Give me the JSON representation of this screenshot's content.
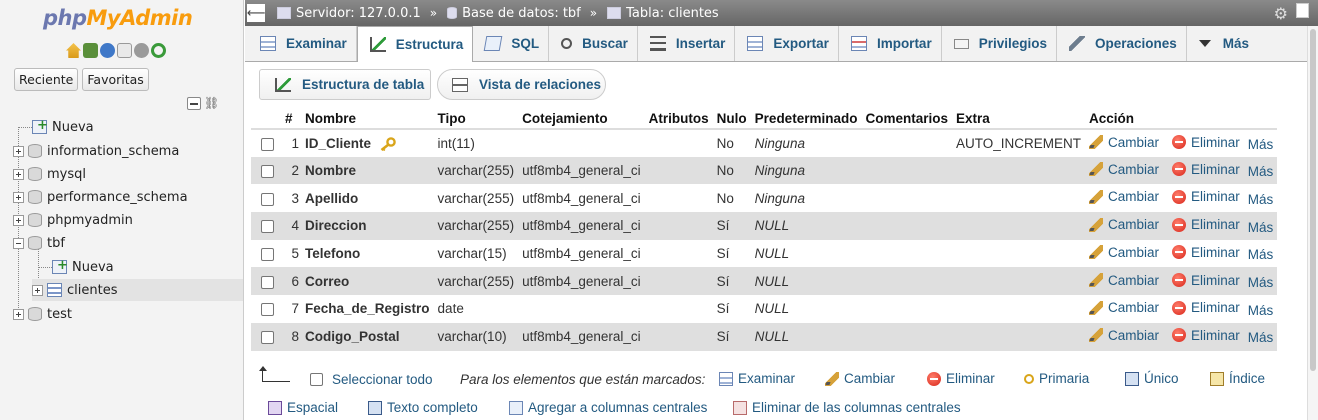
{
  "nav": {
    "logo_a": "php",
    "logo_b": "MyAdmin",
    "btn_recent": "Reciente",
    "btn_fav": "Favoritas",
    "tree": [
      {
        "label": "Nueva",
        "kind": "new",
        "level": 0
      },
      {
        "label": "information_schema",
        "kind": "db",
        "level": 0
      },
      {
        "label": "mysql",
        "kind": "db",
        "level": 0
      },
      {
        "label": "performance_schema",
        "kind": "db",
        "level": 0
      },
      {
        "label": "phpmyadmin",
        "kind": "db",
        "level": 0
      },
      {
        "label": "tbf",
        "kind": "db-open",
        "level": 0
      },
      {
        "label": "Nueva",
        "kind": "new",
        "level": 1
      },
      {
        "label": "clientes",
        "kind": "table",
        "level": 1
      },
      {
        "label": "test",
        "kind": "db",
        "level": 0
      }
    ]
  },
  "breadcrumb": {
    "server": "Servidor: 127.0.0.1",
    "database": "Base de datos: tbf",
    "table": "Tabla: clientes",
    "sep": "»"
  },
  "tabs": [
    {
      "label": "Examinar",
      "icon": "browse-icon"
    },
    {
      "label": "Estructura",
      "icon": "structure-icon",
      "active": true
    },
    {
      "label": "SQL",
      "icon": "sql-icon"
    },
    {
      "label": "Buscar",
      "icon": "search-icon"
    },
    {
      "label": "Insertar",
      "icon": "insert-icon"
    },
    {
      "label": "Exportar",
      "icon": "export-icon"
    },
    {
      "label": "Importar",
      "icon": "import-icon"
    },
    {
      "label": "Privilegios",
      "icon": "privileges-icon"
    },
    {
      "label": "Operaciones",
      "icon": "wrench-icon"
    },
    {
      "label": "Más",
      "icon": "chevron-down-icon"
    }
  ],
  "subtabs": {
    "structure": "Estructura de tabla",
    "relations": "Vista de relaciones"
  },
  "table": {
    "headers": {
      "num": "#",
      "name": "Nombre",
      "type": "Tipo",
      "collation": "Cotejamiento",
      "attributes": "Atributos",
      "null": "Nulo",
      "default": "Predeterminado",
      "comments": "Comentarios",
      "extra": "Extra",
      "action": "Acción"
    },
    "actions": {
      "change": "Cambiar",
      "drop": "Eliminar",
      "more": "Más"
    },
    "rows": [
      {
        "num": "1",
        "name": "ID_Cliente",
        "key": true,
        "type": "int(11)",
        "collation": "",
        "attributes": "",
        "null": "No",
        "default": "Ninguna",
        "comments": "",
        "extra": "AUTO_INCREMENT"
      },
      {
        "num": "2",
        "name": "Nombre",
        "type": "varchar(255)",
        "collation": "utf8mb4_general_ci",
        "attributes": "",
        "null": "No",
        "default": "Ninguna",
        "comments": "",
        "extra": ""
      },
      {
        "num": "3",
        "name": "Apellido",
        "type": "varchar(255)",
        "collation": "utf8mb4_general_ci",
        "attributes": "",
        "null": "No",
        "default": "Ninguna",
        "comments": "",
        "extra": ""
      },
      {
        "num": "4",
        "name": "Direccion",
        "type": "varchar(255)",
        "collation": "utf8mb4_general_ci",
        "attributes": "",
        "null": "Sí",
        "default": "NULL",
        "comments": "",
        "extra": ""
      },
      {
        "num": "5",
        "name": "Telefono",
        "type": "varchar(15)",
        "collation": "utf8mb4_general_ci",
        "attributes": "",
        "null": "Sí",
        "default": "NULL",
        "comments": "",
        "extra": ""
      },
      {
        "num": "6",
        "name": "Correo",
        "type": "varchar(255)",
        "collation": "utf8mb4_general_ci",
        "attributes": "",
        "null": "Sí",
        "default": "NULL",
        "comments": "",
        "extra": ""
      },
      {
        "num": "7",
        "name": "Fecha_de_Registro",
        "type": "date",
        "collation": "",
        "attributes": "",
        "null": "Sí",
        "default": "NULL",
        "comments": "",
        "extra": ""
      },
      {
        "num": "8",
        "name": "Codigo_Postal",
        "type": "varchar(10)",
        "collation": "utf8mb4_general_ci",
        "attributes": "",
        "null": "Sí",
        "default": "NULL",
        "comments": "",
        "extra": ""
      }
    ]
  },
  "bulk": {
    "select_all": "Seleccionar todo",
    "with_selected": "Para los elementos que están marcados:",
    "browse": "Examinar",
    "change": "Cambiar",
    "drop": "Eliminar",
    "primary": "Primaria",
    "unique": "Único",
    "index": "Índice",
    "spatial": "Espacial",
    "fulltext": "Texto completo",
    "add_central": "Agregar a columnas centrales",
    "remove_central": "Eliminar de las columnas centrales"
  }
}
